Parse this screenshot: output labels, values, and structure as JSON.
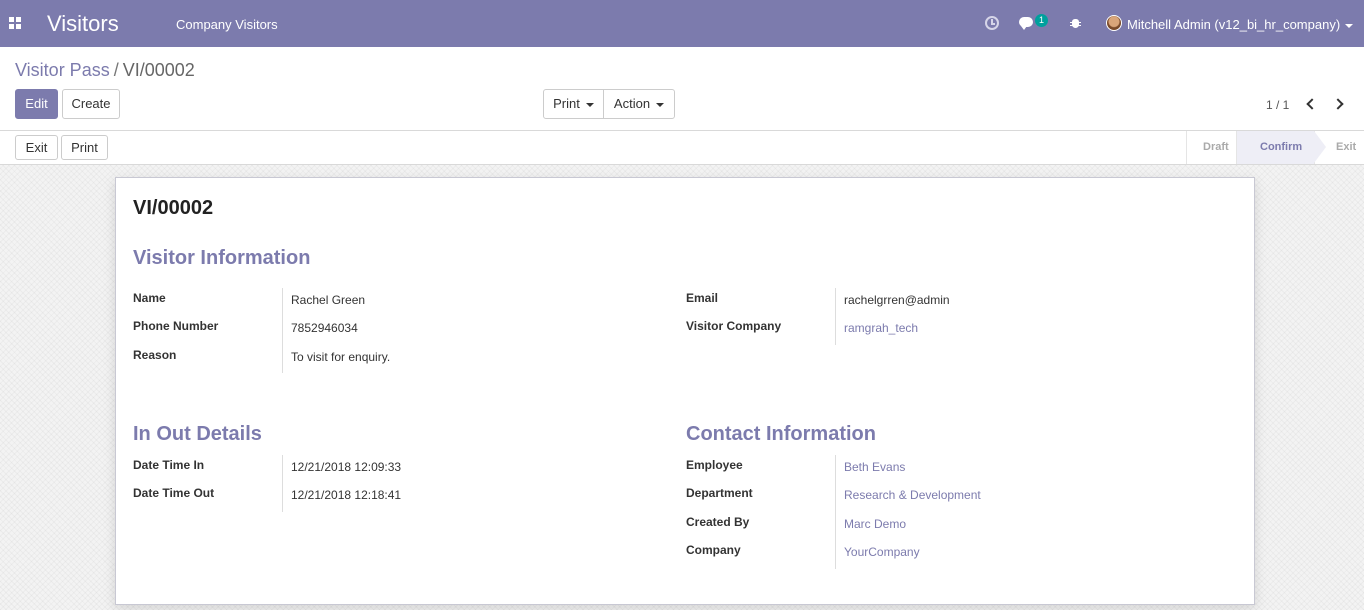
{
  "navbar": {
    "app_title": "Visitors",
    "menu_item": "Company Visitors",
    "chat_badge": "1",
    "user_name": "Mitchell Admin (v12_bi_hr_company)"
  },
  "breadcrumb": {
    "parent": "Visitor Pass",
    "separator": "/",
    "current": "VI/00002"
  },
  "toolbar": {
    "edit_label": "Edit",
    "create_label": "Create",
    "print_label": "Print",
    "action_label": "Action",
    "pager": "1 / 1"
  },
  "statusbar": {
    "exit_label": "Exit",
    "print_label": "Print",
    "stages": [
      {
        "label": "Draft",
        "active": false
      },
      {
        "label": "Confirm",
        "active": true
      },
      {
        "label": "Exit",
        "active": false
      }
    ]
  },
  "form": {
    "record_name": "VI/00002",
    "visitor_info": {
      "title": "Visitor Information",
      "name_label": "Name",
      "name": "Rachel Green",
      "phone_label": "Phone Number",
      "phone": "7852946034",
      "reason_label": "Reason",
      "reason": "To visit for enquiry.",
      "email_label": "Email",
      "email": "rachelgrren@admin",
      "company_label": "Visitor Company",
      "company": "ramgrah_tech"
    },
    "in_out": {
      "title": "In Out Details",
      "in_label": "Date Time In",
      "in_value": "12/21/2018 12:09:33",
      "out_label": "Date Time Out",
      "out_value": "12/21/2018 12:18:41"
    },
    "contact": {
      "title": "Contact Information",
      "employee_label": "Employee",
      "employee": "Beth Evans",
      "department_label": "Department",
      "department": "Research & Development",
      "created_by_label": "Created By",
      "created_by": "Marc Demo",
      "company_label": "Company",
      "company": "YourCompany"
    }
  },
  "colors": {
    "brand": "#7c7bad",
    "badge": "#00a09d"
  }
}
